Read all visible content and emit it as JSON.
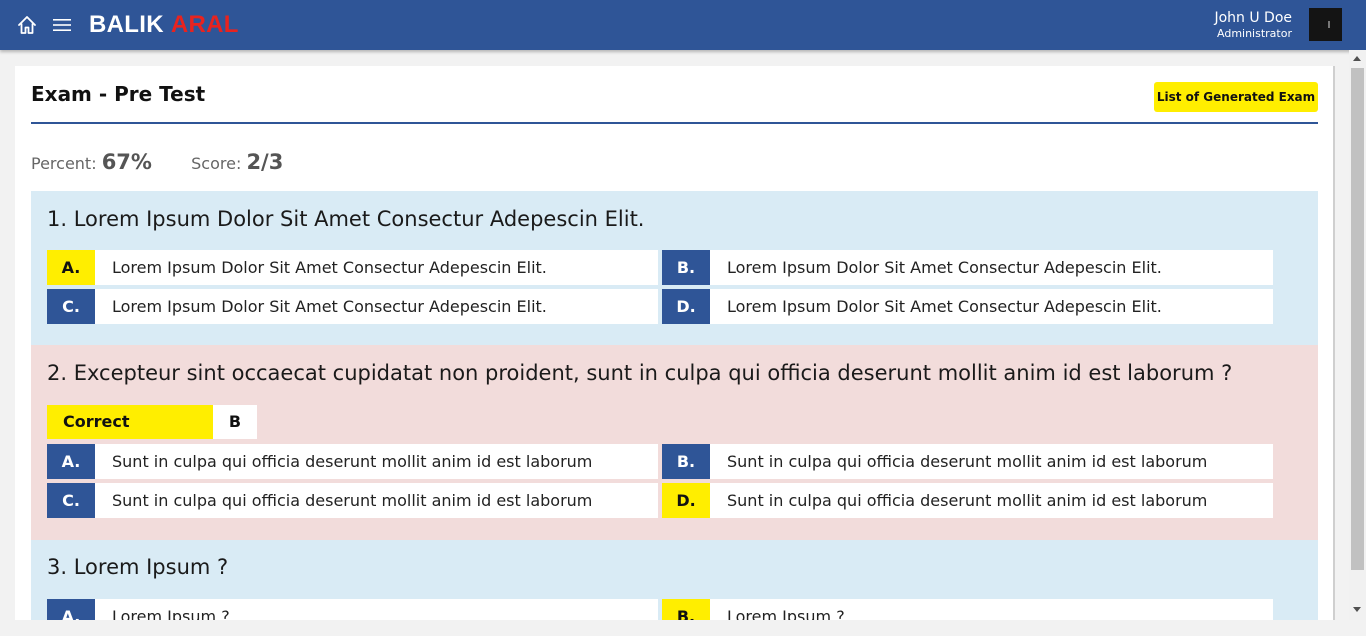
{
  "header": {
    "brand_part1": "BALIK",
    "brand_part2": "ARAL",
    "user_name": "John U Doe",
    "user_role": "Administrator",
    "home_icon": "home-icon",
    "menu_icon": "hamburger-menu-icon",
    "avatar_icon": "avatar"
  },
  "page": {
    "title": "Exam - Pre Test",
    "list_button": "List of Generated Exam",
    "percent_label": "Percent:",
    "percent_value": "67%",
    "score_label": "Score:",
    "score_value": "2/3"
  },
  "questions": [
    {
      "text": "1. Lorem Ipsum Dolor Sit Amet Consectur Adepescin Elit.",
      "status": "correct",
      "options": [
        {
          "letter": "A.",
          "text": "Lorem Ipsum Dolor Sit Amet Consectur Adepescin Elit.",
          "selected": true
        },
        {
          "letter": "B.",
          "text": "Lorem Ipsum Dolor Sit Amet Consectur Adepescin Elit.",
          "selected": false
        },
        {
          "letter": "C.",
          "text": "Lorem Ipsum Dolor Sit Amet Consectur Adepescin Elit.",
          "selected": false
        },
        {
          "letter": "D.",
          "text": "Lorem Ipsum Dolor Sit Amet Consectur Adepescin Elit.",
          "selected": false
        }
      ]
    },
    {
      "text": "2. Excepteur sint occaecat cupidatat non proident, sunt in culpa qui officia deserunt mollit anim id est laborum ?",
      "status": "wrong",
      "correct_label": "Correct Answer.",
      "correct_value": "B",
      "options": [
        {
          "letter": "A.",
          "text": "Sunt in culpa qui officia deserunt mollit anim id est laborum",
          "selected": false
        },
        {
          "letter": "B.",
          "text": "Sunt in culpa qui officia deserunt mollit anim id est laborum",
          "selected": false
        },
        {
          "letter": "C.",
          "text": "Sunt in culpa qui officia deserunt mollit anim id est laborum",
          "selected": false
        },
        {
          "letter": "D.",
          "text": "Sunt in culpa qui officia deserunt mollit anim id est laborum",
          "selected": true
        }
      ]
    },
    {
      "text": "3. Lorem Ipsum ?",
      "status": "correct",
      "options": [
        {
          "letter": "A.",
          "text": "Lorem Ipsum ?",
          "selected": false
        },
        {
          "letter": "B.",
          "text": "Lorem Ipsum ?",
          "selected": true
        }
      ]
    }
  ],
  "colors": {
    "primary": "#2f5597",
    "accent_yellow": "#ffee00",
    "brand_red": "#e8231f",
    "correct_bg": "#d9ebf5",
    "wrong_bg": "#f2dcdb"
  }
}
